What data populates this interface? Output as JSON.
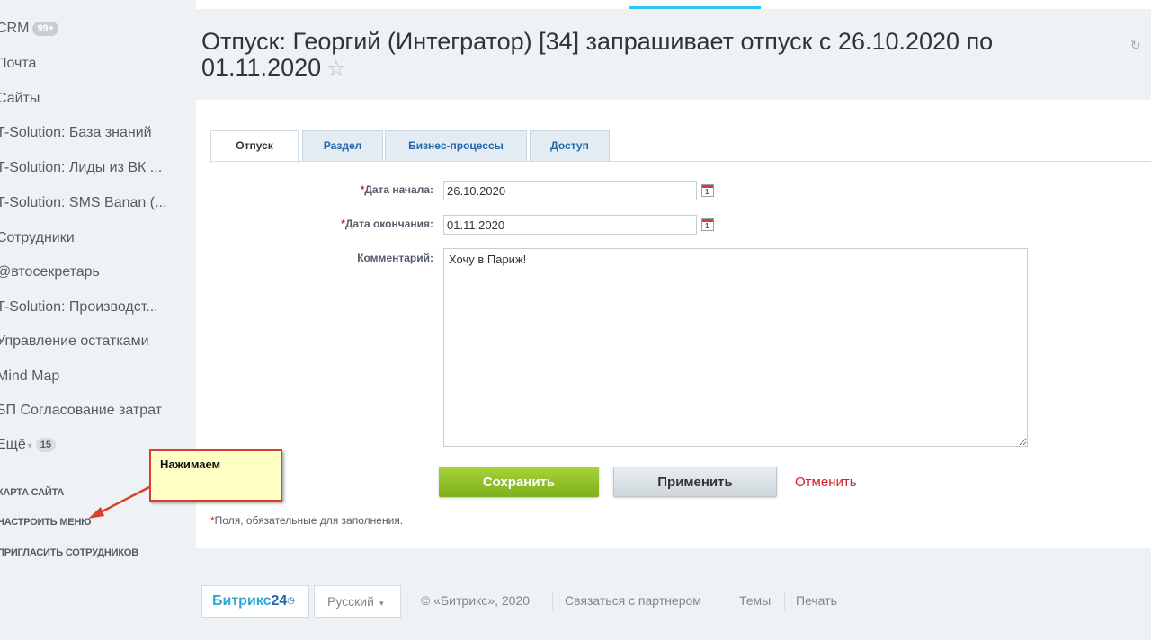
{
  "sidebar": {
    "crm": {
      "label": "CRM",
      "badge": "99+"
    },
    "items": [
      {
        "label": "Почта"
      },
      {
        "label": "Сайты"
      },
      {
        "label": "T-Solution: База знаний"
      },
      {
        "label": "T-Solution: Лиды из ВК ..."
      },
      {
        "label": "T-Solution: SMS Banan (..."
      },
      {
        "label": "Сотрудники"
      },
      {
        "label": "@втосекретарь"
      },
      {
        "label": "T-Solution: Производст..."
      },
      {
        "label": "Управление остатками"
      },
      {
        "label": "Mind Map"
      },
      {
        "label": "БП Согласование затрат"
      }
    ],
    "more": {
      "label": "Ещё",
      "badge": "15"
    },
    "system_links": {
      "sitemap": "Карта сайта",
      "configure_menu": "Настроить меню",
      "invite": "Пригласить сотрудников"
    }
  },
  "header": {
    "title": "Отпуск: Георгий (Интегратор) [34] запрашивает отпуск с 26.10.2020 по 01.11.2020"
  },
  "tabs": [
    {
      "label": "Отпуск"
    },
    {
      "label": "Раздел"
    },
    {
      "label": "Бизнес-процессы"
    },
    {
      "label": "Доступ"
    }
  ],
  "form": {
    "required_mark": "*",
    "start_date": {
      "label": "Дата начала:",
      "value": "26.10.2020"
    },
    "end_date": {
      "label": "Дата окончания:",
      "value": "01.11.2020"
    },
    "comment": {
      "label": "Комментарий:",
      "value": "Хочу в Париж!"
    },
    "calendar_day": "1",
    "save_label": "Сохранить",
    "apply_label": "Применить",
    "cancel_label": "Отменить",
    "required_note": "Поля, обязательные для заполнения."
  },
  "footer": {
    "logo_text": "Битрикс",
    "logo_num": "24",
    "language": "Русский",
    "copyright": "© «Битрикс», 2020",
    "partner": "Связаться с партнером",
    "themes": "Темы",
    "print": "Печать"
  },
  "annotation": {
    "text": "Нажимаем",
    "color": "#d8402c"
  },
  "colors": {
    "accent": "#2067b0",
    "save_button": "#8bc21f",
    "cancel": "#d0202a"
  }
}
